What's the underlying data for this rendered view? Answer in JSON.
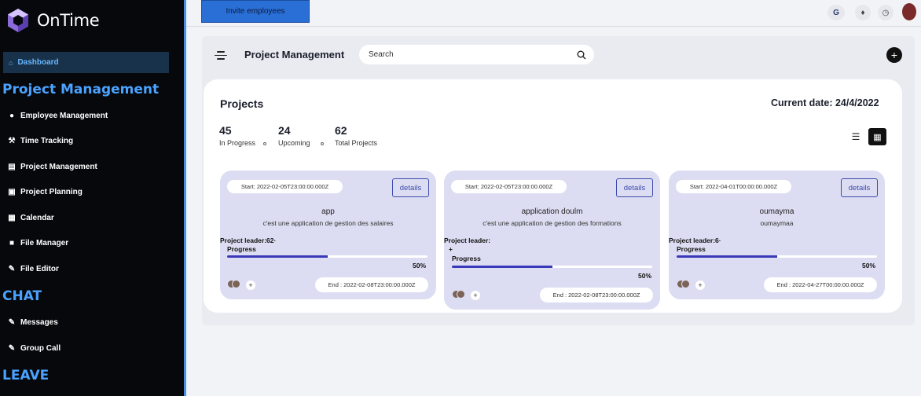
{
  "app": {
    "name": "OnTime"
  },
  "sidebar": {
    "dashboard": "Dashboard",
    "sections": {
      "project_management": "Project Management",
      "chat": "CHAT",
      "leave": "LEAVE"
    },
    "items": [
      {
        "label": "Employee Management",
        "icon": "user-icon"
      },
      {
        "label": "Time Tracking",
        "icon": "wrench-icon"
      },
      {
        "label": "Project Management",
        "icon": "document-icon"
      },
      {
        "label": "Project Planning",
        "icon": "box-icon"
      },
      {
        "label": "Calendar",
        "icon": "calendar-icon"
      },
      {
        "label": "File Manager",
        "icon": "folder-icon"
      },
      {
        "label": "File Editor",
        "icon": "edit-icon"
      },
      {
        "label": "Messages",
        "icon": "message-icon"
      },
      {
        "label": "Group Call",
        "icon": "call-icon"
      }
    ]
  },
  "topbar": {
    "invite_label": "Invite employees",
    "google_label": "G"
  },
  "header": {
    "title": "Project Management",
    "search_placeholder": "Search"
  },
  "projects": {
    "title": "Projects",
    "current_date": "Current date: 24/4/2022",
    "stats": [
      {
        "value": "45",
        "label": "In Progress"
      },
      {
        "value": "24",
        "label": "Upcoming"
      },
      {
        "value": "62",
        "label": "Total Projects"
      }
    ],
    "cards": [
      {
        "start": "Start: 2022-02-05T23:00:00.000Z",
        "details": "details",
        "name": "app",
        "description": "c'est une application de gestion des salaires",
        "leader": "Project leader:62·",
        "progress_label": "Progress",
        "progress": 0.5,
        "percent": "50%",
        "end": "End : 2022-02-08T23:00:00.000Z"
      },
      {
        "start": "Start: 2022-02-05T23:00:00.000Z",
        "details": "details",
        "name": "application doulm",
        "description": "c'est une application de gestion des formations",
        "leader": "Project leader:",
        "progress_label": "Progress",
        "progress": 0.5,
        "percent": "50%",
        "end": "End : 2022-02-08T23:00:00.000Z"
      },
      {
        "start": "Start: 2022-04-01T00:00:00.000Z",
        "details": "details",
        "name": "oumayma",
        "description": "oumaymaa",
        "leader": "Project leader:6·",
        "progress_label": "Progress",
        "progress": 0.5,
        "percent": "50%",
        "end": "End : 2022-04-27T00:00:00.000Z"
      }
    ]
  },
  "colors": {
    "sidebar_bg": "#06080c",
    "accent_blue": "#4aa3ff",
    "invite_btn": "#2a6fd6",
    "card_bg": "#dcddf2",
    "progress_fill": "#3838b8"
  }
}
